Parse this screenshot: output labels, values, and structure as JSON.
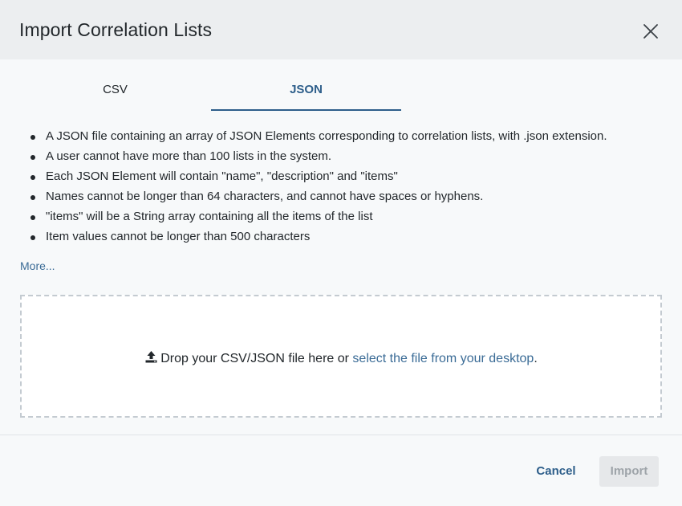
{
  "dialog": {
    "title": "Import Correlation Lists",
    "close_icon": "close-icon"
  },
  "tabs": [
    {
      "label": "CSV",
      "active": false
    },
    {
      "label": "JSON",
      "active": true
    }
  ],
  "rules": [
    "A JSON file containing an array of JSON Elements corresponding to correlation lists, with .json extension.",
    "A user cannot have more than 100 lists in the system.",
    "Each JSON Element will contain \"name\", \"description\" and \"items\"",
    "Names cannot be longer than 64 characters, and cannot have spaces or hyphens.",
    "\"items\" will be a String array containing all the items of the list",
    "Item values cannot be longer than 500 characters"
  ],
  "more_link": "More...",
  "dropzone": {
    "icon": "upload-icon",
    "text": "Drop your CSV/JSON file here or ",
    "link": "select the file from your desktop",
    "suffix": "."
  },
  "footer": {
    "cancel_label": "Cancel",
    "import_label": "Import",
    "import_enabled": false
  },
  "colors": {
    "accent": "#2d5e8a",
    "link": "#3a6b96",
    "disabled_text": "#9ea4a9",
    "header_bg": "#eceef0"
  }
}
